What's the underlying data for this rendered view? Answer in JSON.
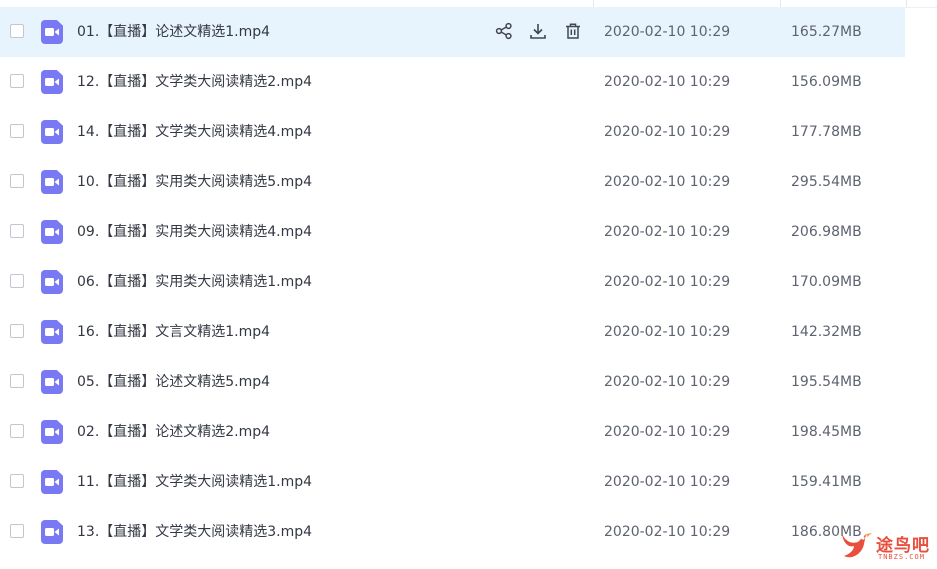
{
  "files": [
    {
      "name": "01.【直播】论述文精选1.mp4",
      "time": "2020-02-10 10:29",
      "size": "165.27MB",
      "selected": true
    },
    {
      "name": "12.【直播】文学类大阅读精选2.mp4",
      "time": "2020-02-10 10:29",
      "size": "156.09MB"
    },
    {
      "name": "14.【直播】文学类大阅读精选4.mp4",
      "time": "2020-02-10 10:29",
      "size": "177.78MB"
    },
    {
      "name": "10.【直播】实用类大阅读精选5.mp4",
      "time": "2020-02-10 10:29",
      "size": "295.54MB"
    },
    {
      "name": "09.【直播】实用类大阅读精选4.mp4",
      "time": "2020-02-10 10:29",
      "size": "206.98MB"
    },
    {
      "name": "06.【直播】实用类大阅读精选1.mp4",
      "time": "2020-02-10 10:29",
      "size": "170.09MB"
    },
    {
      "name": "16.【直播】文言文精选1.mp4",
      "time": "2020-02-10 10:29",
      "size": "142.32MB"
    },
    {
      "name": "05.【直播】论述文精选5.mp4",
      "time": "2020-02-10 10:29",
      "size": "195.54MB"
    },
    {
      "name": "02.【直播】论述文精选2.mp4",
      "time": "2020-02-10 10:29",
      "size": "198.45MB"
    },
    {
      "name": "11.【直播】文学类大阅读精选1.mp4",
      "time": "2020-02-10 10:29",
      "size": "159.41MB"
    },
    {
      "name": "13.【直播】文学类大阅读精选3.mp4",
      "time": "2020-02-10 10:29",
      "size": "186.80MB"
    }
  ],
  "row_actions": [
    {
      "icon": "share-icon"
    },
    {
      "icon": "download-icon"
    },
    {
      "icon": "delete-icon"
    }
  ],
  "watermark": {
    "text": "途鸟吧",
    "sub": "TNBZS.COM"
  },
  "colors": {
    "selected_row": "#e8f4fd",
    "video_icon": "#7a79f4",
    "watermark": "#e84f3c"
  }
}
